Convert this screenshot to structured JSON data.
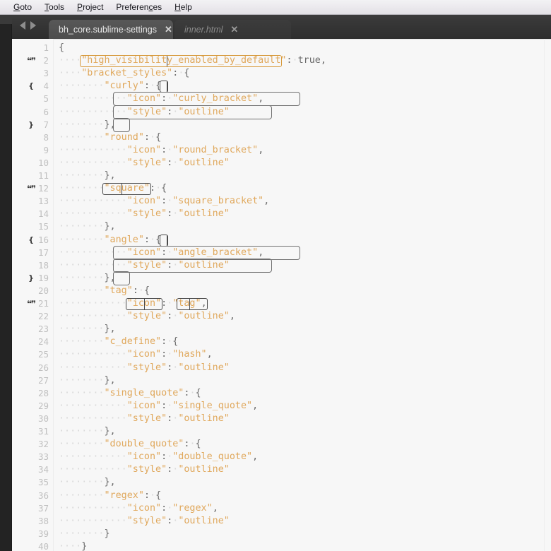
{
  "menu": {
    "items": [
      {
        "label": "Goto",
        "mnemonic_index": 0
      },
      {
        "label": "Tools",
        "mnemonic_index": 0
      },
      {
        "label": "Project",
        "mnemonic_index": 0
      },
      {
        "label": "Preferences",
        "mnemonic_index": 8
      },
      {
        "label": "Help",
        "mnemonic_index": 0
      }
    ]
  },
  "tabbar": {
    "nav_prev_icon": "arrow-left-icon",
    "nav_next_icon": "arrow-right-icon",
    "tabs": [
      {
        "label": "bh_core.sublime-settings",
        "active": true,
        "italic": false,
        "close_label": "✕"
      },
      {
        "label": "inner.html",
        "active": false,
        "italic": true,
        "close_label": "✕"
      }
    ]
  },
  "editor": {
    "colors": {
      "background": "#f7f7f7",
      "string": "#e0a85c",
      "punctuation": "#6b6b6b",
      "line_number": "#c0c0c0",
      "bracket_outline": "#d79a3c",
      "region_outline": "#6f6f6f",
      "cursor": "#4b4b4b"
    },
    "lines": [
      {
        "n": "1",
        "gutter": "",
        "code": "{"
      },
      {
        "n": "2",
        "gutter": "quote",
        "code": "····\"high_visibility_enabled_by_default\":·true,"
      },
      {
        "n": "3",
        "gutter": "",
        "code": "····\"bracket_styles\":·{"
      },
      {
        "n": "4",
        "gutter": "brace-open",
        "code": "········\"curly\":·{"
      },
      {
        "n": "5",
        "gutter": "",
        "code": "············\"icon\":·\"curly_bracket\","
      },
      {
        "n": "6",
        "gutter": "",
        "code": "············\"style\":·\"outline\""
      },
      {
        "n": "7",
        "gutter": "brace-close",
        "code": "········},"
      },
      {
        "n": "8",
        "gutter": "",
        "code": "········\"round\":·{"
      },
      {
        "n": "9",
        "gutter": "",
        "code": "············\"icon\":·\"round_bracket\","
      },
      {
        "n": "10",
        "gutter": "",
        "code": "············\"style\":·\"outline\""
      },
      {
        "n": "11",
        "gutter": "",
        "code": "········},"
      },
      {
        "n": "12",
        "gutter": "quote",
        "code": "········\"square\":·{"
      },
      {
        "n": "13",
        "gutter": "",
        "code": "············\"icon\":·\"square_bracket\","
      },
      {
        "n": "14",
        "gutter": "",
        "code": "············\"style\":·\"outline\""
      },
      {
        "n": "15",
        "gutter": "",
        "code": "········},"
      },
      {
        "n": "16",
        "gutter": "brace-open",
        "code": "········\"angle\":·{"
      },
      {
        "n": "17",
        "gutter": "",
        "code": "············\"icon\":·\"angle_bracket\","
      },
      {
        "n": "18",
        "gutter": "",
        "code": "············\"style\":·\"outline\""
      },
      {
        "n": "19",
        "gutter": "brace-close",
        "code": "········},"
      },
      {
        "n": "20",
        "gutter": "",
        "code": "········\"tag\":·{"
      },
      {
        "n": "21",
        "gutter": "quote",
        "code": "············\"icon\":·\"tag\","
      },
      {
        "n": "22",
        "gutter": "",
        "code": "············\"style\":·\"outline\","
      },
      {
        "n": "23",
        "gutter": "",
        "code": "········},"
      },
      {
        "n": "24",
        "gutter": "",
        "code": "········\"c_define\":·{"
      },
      {
        "n": "25",
        "gutter": "",
        "code": "············\"icon\":·\"hash\","
      },
      {
        "n": "26",
        "gutter": "",
        "code": "············\"style\":·\"outline\""
      },
      {
        "n": "27",
        "gutter": "",
        "code": "········},"
      },
      {
        "n": "28",
        "gutter": "",
        "code": "········\"single_quote\":·{"
      },
      {
        "n": "29",
        "gutter": "",
        "code": "············\"icon\":·\"single_quote\","
      },
      {
        "n": "30",
        "gutter": "",
        "code": "············\"style\":·\"outline\""
      },
      {
        "n": "31",
        "gutter": "",
        "code": "········},"
      },
      {
        "n": "32",
        "gutter": "",
        "code": "········\"double_quote\":·{"
      },
      {
        "n": "33",
        "gutter": "",
        "code": "············\"icon\":·\"double_quote\","
      },
      {
        "n": "34",
        "gutter": "",
        "code": "············\"style\":·\"outline\""
      },
      {
        "n": "35",
        "gutter": "",
        "code": "········},"
      },
      {
        "n": "36",
        "gutter": "",
        "code": "········\"regex\":·{"
      },
      {
        "n": "37",
        "gutter": "",
        "code": "············\"icon\":·\"regex\","
      },
      {
        "n": "38",
        "gutter": "",
        "code": "············\"style\":·\"outline\""
      },
      {
        "n": "39",
        "gutter": "",
        "code": "········}"
      },
      {
        "n": "40",
        "gutter": "",
        "code": "····}"
      }
    ],
    "gutter_glyphs": {
      "quote": "❝❞",
      "brace-open": "{",
      "brace-close": "}"
    }
  }
}
